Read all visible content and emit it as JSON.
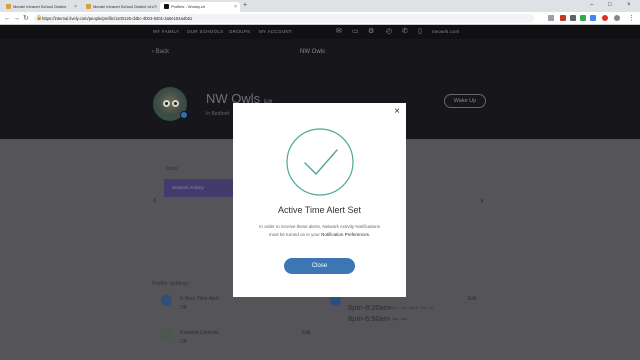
{
  "browser": {
    "tabs": [
      {
        "label": "Meraki Intranet School District",
        "active": false
      },
      {
        "label": "Meraki Intranet School District Uni...",
        "active": false
      },
      {
        "label": "Profiles - Wonky.ch",
        "active": true
      }
    ],
    "url": "https://internal.lively.com/people/profile/1100125-d4bc-4b04-9201-3a0e104a4b51",
    "new_tab": "+"
  },
  "site_nav": {
    "links": [
      "MY FAMILY",
      "OUR SCHOOLS",
      "GROUPS",
      "MY ACCOUNT"
    ],
    "user_label": "nwowls.com"
  },
  "profile": {
    "back_label": "Back",
    "page_title": "NW Owls",
    "name": "NW Owls",
    "name_suffix": "Edit",
    "subtitle": "In Bedford",
    "wake_up_label": "Wake Up"
  },
  "body": {
    "today_label": "Today",
    "alert_strip_text": "Network Activity",
    "settings_title": "Profile Settings",
    "settings": [
      {
        "label": "5-Hour Time Alert",
        "value": "Off",
        "edit": "Edit"
      },
      {
        "label": "Parental Controls",
        "value": "Off",
        "edit": "Edit"
      }
    ],
    "schedule": [
      {
        "time": "6pm-8:20am",
        "note": "Mon, Tue, Wed, Thu, Fri"
      },
      {
        "time": "8pm-6:50am",
        "note": "Sat, Sun"
      }
    ],
    "schedule_edit": "Edit"
  },
  "modal": {
    "title": "Active Time Alert Set",
    "body_pre": "In order to receive these alerts, Network Activity Notifications must be turned on in your",
    "body_link": "Notification Preferences",
    "body_post": ".",
    "close_label": "Close",
    "close_icon": "×"
  },
  "colors": {
    "accent": "#3c77b4",
    "check": "#4fa79a"
  }
}
